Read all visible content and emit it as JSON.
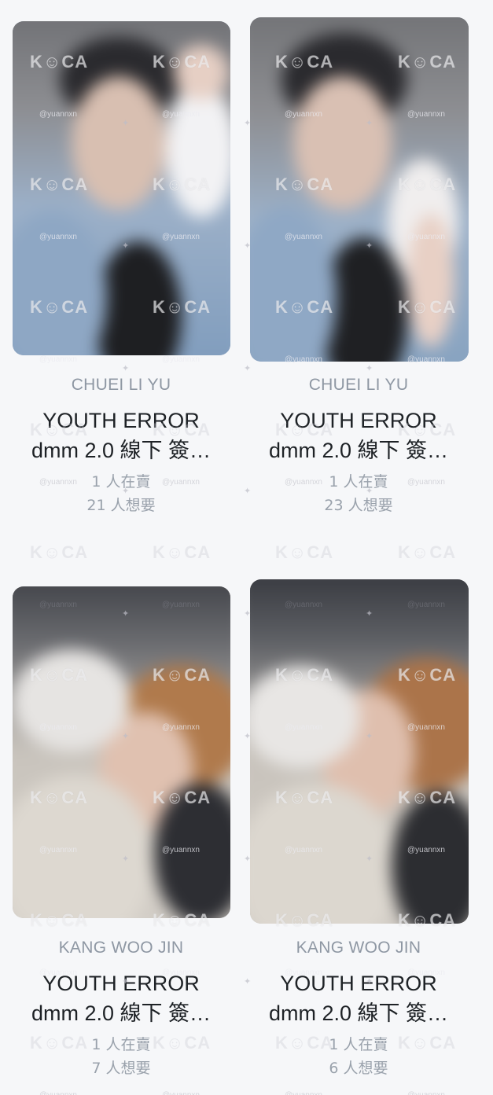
{
  "watermark": {
    "brand": "K☺CA",
    "handle": "@yuannxn"
  },
  "cards": [
    {
      "artist": "CHUEI LI YU",
      "title_line1": "YOUTH ERROR",
      "title_line2": "dmm 2.0 線下 簽…",
      "selling": "1 人在賣",
      "wanting": "21 人想要"
    },
    {
      "artist": "CHUEI LI YU",
      "title_line1": "YOUTH ERROR",
      "title_line2": "dmm 2.0 線下 簽…",
      "selling": "1 人在賣",
      "wanting": "23 人想要"
    },
    {
      "artist": "KANG WOO JIN",
      "title_line1": "YOUTH ERROR",
      "title_line2": "dmm 2.0 線下 簽…",
      "selling": "1 人在賣",
      "wanting": "7 人想要"
    },
    {
      "artist": "KANG WOO JIN",
      "title_line1": "YOUTH ERROR",
      "title_line2": "dmm 2.0 線下 簽…",
      "selling": "1 人在賣",
      "wanting": "6 人想要"
    }
  ]
}
